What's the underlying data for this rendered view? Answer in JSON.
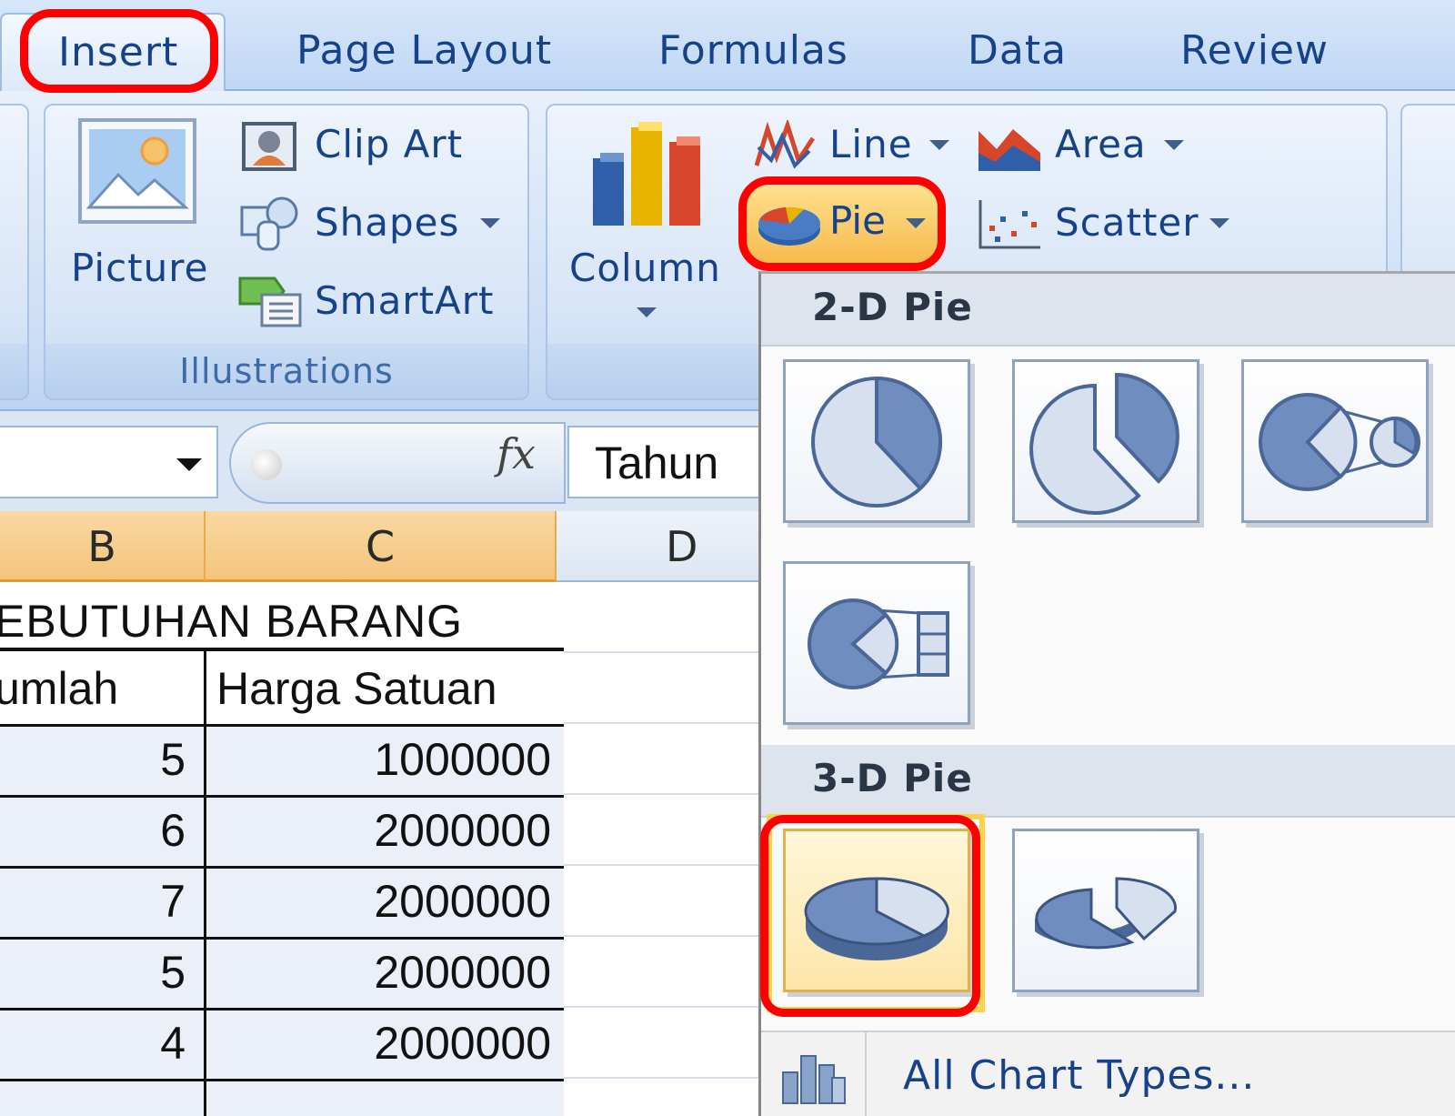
{
  "ribbon_tabs": {
    "insert": "Insert",
    "page_layout": "Page Layout",
    "formulas": "Formulas",
    "data": "Data",
    "review": "Review"
  },
  "illustrations": {
    "picture": "Picture",
    "clip_art": "Clip Art",
    "shapes": "Shapes",
    "smartart": "SmartArt",
    "group_label": "Illustrations"
  },
  "charts": {
    "column": "Column",
    "line": "Line",
    "pie": "Pie",
    "area": "Area",
    "scatter": "Scatter"
  },
  "formula_bar": {
    "fx_label": "fx",
    "content": "Tahun"
  },
  "columns": [
    "B",
    "C",
    "D"
  ],
  "sheet": {
    "title_fragment": "EBUTUHAN BARANG",
    "headers": [
      "umlah",
      "Harga Satuan"
    ],
    "rows": [
      {
        "jumlah": "5",
        "harga": "1000000"
      },
      {
        "jumlah": "6",
        "harga": "2000000"
      },
      {
        "jumlah": "7",
        "harga": "2000000"
      },
      {
        "jumlah": "5",
        "harga": "2000000"
      },
      {
        "jumlah": "4",
        "harga": "2000000"
      }
    ]
  },
  "pie_gallery": {
    "section_2d": "2-D Pie",
    "section_3d": "3-D Pie",
    "all_chart_types": "All Chart Types..."
  },
  "colors": {
    "highlight": "#ff0000",
    "ribbon_text": "#15428b",
    "column_header_selected": "#f4c47b"
  }
}
